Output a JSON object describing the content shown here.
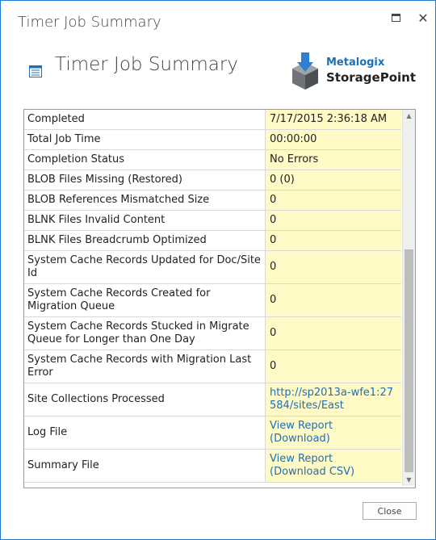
{
  "window": {
    "title": "Timer Job Summary",
    "maximize_icon": "maximize-icon",
    "close_icon": "close-icon"
  },
  "header": {
    "title": "Timer Job Summary",
    "logo": {
      "line1": "Metalogix",
      "line2": "StoragePoint"
    }
  },
  "summary": {
    "rows": [
      {
        "label": "Completed",
        "value": "7/17/2015 2:36:18 AM",
        "link": false
      },
      {
        "label": "Total Job Time",
        "value": "00:00:00",
        "link": false
      },
      {
        "label": "Completion Status",
        "value": "No Errors",
        "link": false
      },
      {
        "label": "BLOB Files Missing (Restored)",
        "value": "0 (0)",
        "link": false
      },
      {
        "label": "BLOB References Mismatched Size",
        "value": "0",
        "link": false
      },
      {
        "label": "BLNK Files Invalid Content",
        "value": "0",
        "link": false
      },
      {
        "label": "BLNK Files Breadcrumb Optimized",
        "value": "0",
        "link": false
      },
      {
        "label": "System Cache Records Updated for Doc/Site Id",
        "value": "0",
        "link": false
      },
      {
        "label": "System Cache Records Created for Migration Queue",
        "value": "0",
        "link": false
      },
      {
        "label": "System Cache Records Stucked in Migrate Queue for Longer than One Day",
        "value": "0",
        "link": false
      },
      {
        "label": "System Cache Records with Migration Last Error",
        "value": "0",
        "link": false
      },
      {
        "label": "Site Collections Processed",
        "value": "http://sp2013a-wfe1:27584/sites/East",
        "link": true
      },
      {
        "label": "Log File",
        "value": "View Report",
        "value2": "(Download)",
        "link": true
      },
      {
        "label": "Summary File",
        "value": "View Report",
        "value2": "(Download CSV)",
        "link": true
      }
    ]
  },
  "footer": {
    "close_label": "Close"
  },
  "colors": {
    "accent": "#1e7ad4",
    "value_bg": "#fff9c6",
    "link": "#1f6fb4"
  }
}
